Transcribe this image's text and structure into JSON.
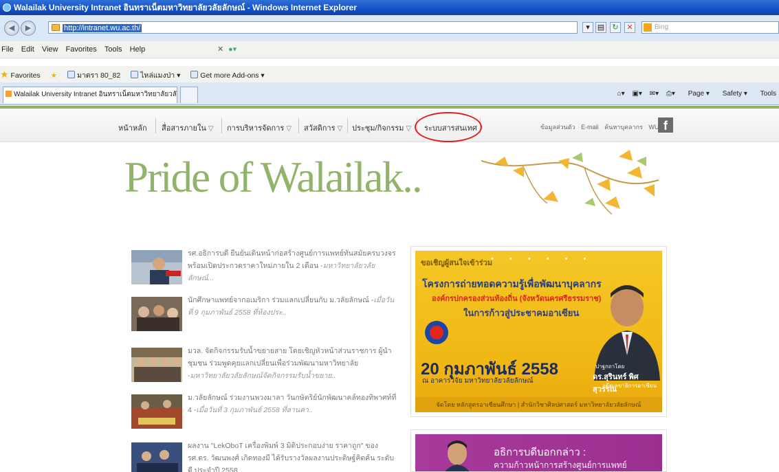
{
  "window": {
    "title": "Walailak University Intranet อินทราเน็ตมหาวิทยาลัยวลัยลักษณ์ - Windows Internet Explorer"
  },
  "addressbar": {
    "url": "http://intranet.wu.ac.th/",
    "search_placeholder": "Bing"
  },
  "menubar": {
    "items": [
      "File",
      "Edit",
      "View",
      "Favorites",
      "Tools",
      "Help"
    ]
  },
  "favbar": {
    "favorites_label": "Favorites",
    "items": [
      "มาตรา 80_82",
      "ไหล่แมงป่า",
      "Get more Add-ons"
    ]
  },
  "tabbar": {
    "tab_title": "Walailak University Intranet อินทราเน็ตมหาวิทยาลัยวลั...",
    "commands": [
      "Page",
      "Safety",
      "Tools"
    ]
  },
  "site_nav": {
    "items": [
      "หน้าหลัก",
      "สื่อสารภายใน",
      "การบริหารจัดการ",
      "สวัสดิการ",
      "ประชุม/กิจกรรม",
      "ระบบสารสนเทศ"
    ],
    "right_links": [
      "ข้อมูลส่วนตัว",
      "E-mail",
      "ค้นหาบุคลากร",
      "WU"
    ],
    "facebook": "f"
  },
  "hero": {
    "title": "Pride of Walailak.."
  },
  "news": [
    {
      "text": "รศ.อธิการบดี ยืนยันเดินหน้าก่อสร้างศูนย์การแพทย์ทันสมัยครบวงจร พร้อมเปิดประกวดราคาใหม่ภายใน 2 เดือน -",
      "source": "มหาวิทยาลัยวลัยลักษณ์..."
    },
    {
      "text": "นักศึกษาแพทย์จากอเมริกา ร่วมแลกเปลี่ยนกับ ม.วลัยลักษณ์ -",
      "source": "เมื่อวันที่ 9 กุมภาพันธ์ 2558 ที่ห้องประ.."
    },
    {
      "text": "มวล. จัดกิจกรรมรับน้ำขยายสาย โดยเชิญหัวหน้าส่วนราชการ ผู้นำชุมชน ร่วมพูดคุยแลกเปลี่ยนเพื่อร่วมพัฒนามหาวิทยาลัย -",
      "source": "มหาวิทยาลัยวลัยลักษณ์จัดกิจกรรมรับน้ำขยาย.."
    },
    {
      "text": "ม.วลัยลักษณ์ ร่วมงานพวงมาลา วันกษัตริย์นักพัฒนาคล์ทองทิพาศท์ที่ 4 -",
      "source": "เมื่อวันที่ 3 กุมภาพันธ์ 2558 ที่ลานคา.."
    },
    {
      "text": "ผลงาน \"LekOboT เครื่องพิมพ์ 3 มิติประกอบง่าย ราคาถูก\" ของ รศ.ดร. วัฒนพงศ์ เกิดทองมี ได้รับรางวัลผลงานประดิษฐ์คิดค้น ระดับดี ประจำปี 2558",
      "source": ""
    }
  ],
  "banner1": {
    "invite": "ขอเชิญผู้สนใจเข้าร่วม",
    "title": "โครงการถ่ายทอดความรู้เพื่อพัฒนาบุคลากร",
    "sub1": "องค์กรปกครองส่วนท้องถิ่น (จังหวัดนครศรีธรรมราช)",
    "sub2": "ในการก้าวสู่ประชาคมอาเซียน",
    "date": "20 กุมภาพันธ์ 2558",
    "venue": "ณ อาคารวิจัย มหาวิทยาลัยวลัยลักษณ์",
    "speaker_role": "ปาฐกถาโดย",
    "speaker_name": "ดร.สุรินทร์ พิศสุวรรณ",
    "speaker_title": "อดีตเลขาธิการอาเซียน",
    "organizer": "จัดโดย หลักสูตรอาเซียนศึกษา | สำนักวิชาศิลปศาสตร์ มหาวิทยาลัยวลัยลักษณ์"
  },
  "banner2": {
    "title": "อธิการบดีบอกกล่าว :",
    "subtitle": "ความก้าวหน้าการสร้างศูนย์การแพทย์"
  },
  "colors": {
    "accent_green": "#92b46a",
    "highlight_red": "#e02020",
    "banner_yellow": "#f0b714",
    "banner_purple": "#a93a9c"
  }
}
